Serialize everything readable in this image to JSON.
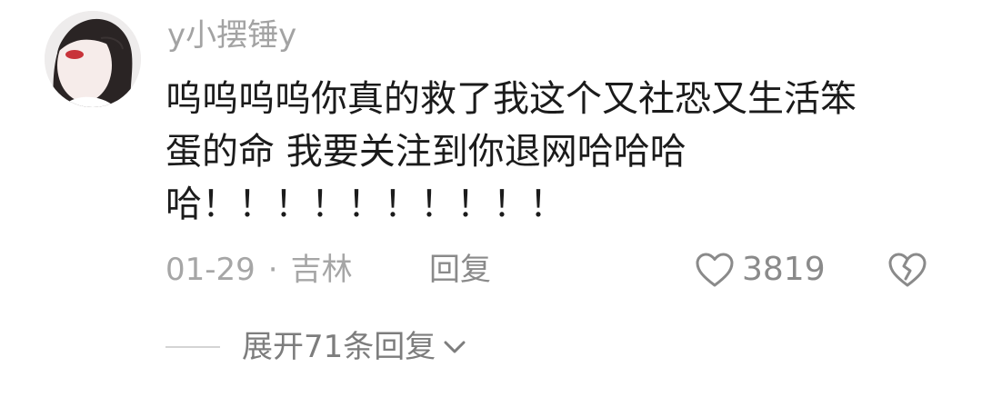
{
  "comment": {
    "username": "y小摆锤y",
    "text_lines": [
      "呜呜呜呜你真的救了我这个又社恐又生活笨",
      "蛋的命 我要关注到你退网哈哈哈",
      "哈！！！！！！！！！！"
    ],
    "date": "01-29",
    "separator": "·",
    "location": "吉林",
    "reply_label": "回复",
    "like_count": "3819",
    "expand_replies_label": "展开71条回复"
  },
  "icons": {
    "like": "heart-outline-icon",
    "dislike": "broken-heart-icon",
    "expand": "chevron-down-icon"
  },
  "colors": {
    "username": "#a3a3a3",
    "text": "#1b1b1b",
    "meta": "#a6a6a6",
    "action": "#8a8a8a"
  }
}
